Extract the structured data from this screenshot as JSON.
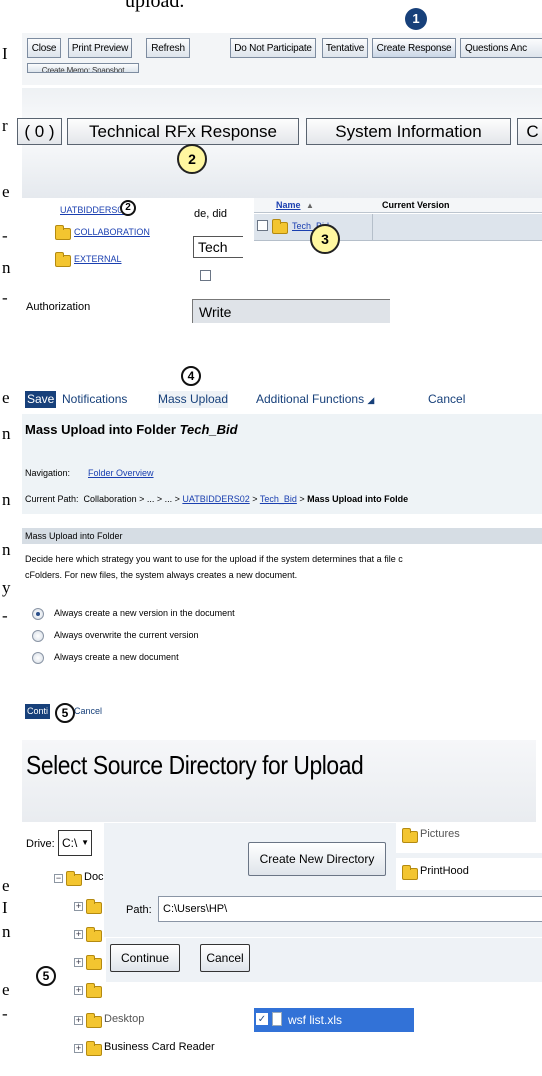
{
  "doc_fragments": {
    "top": "upload.",
    "left_letters": [
      "I",
      "r",
      "e",
      "-",
      "n",
      "-",
      "e",
      "n",
      "n",
      "n",
      "y",
      "-",
      "e",
      "I",
      "n",
      "e",
      "-"
    ]
  },
  "toolbar1": {
    "buttons": [
      "Close",
      "Print Preview",
      "Refresh",
      "Do Not Participate",
      "Tentative",
      "Create Response",
      "Questions Anc"
    ],
    "second_row": "Create Memo: Snapshot"
  },
  "tabs": {
    "count": "( 0 )",
    "technical": "Technical RFx Response",
    "system": "System Information",
    "extra": "C"
  },
  "folders": {
    "tree": [
      "UATBIDDERS02",
      "COLLABORATION",
      "EXTERNAL"
    ],
    "fragment_text": "de, did",
    "tech_field": "Tech",
    "auth_label": "Authorization",
    "auth_value": "Write",
    "col_name": "Name",
    "col_version": "Current Version",
    "row_name": "Tech_Bid"
  },
  "toolbar2": {
    "save": "Save",
    "notifications": "Notifications",
    "mass_upload": "Mass Upload",
    "additional": "Additional Functions",
    "cancel": "Cancel"
  },
  "mass_upload": {
    "title_prefix": "Mass Upload into Folder ",
    "title_folder": "Tech_Bid",
    "nav_label": "Navigation:",
    "nav_link": "Folder Overview",
    "path_label": "Current Path:",
    "path_pre": "Collaboration > ... > ... > ",
    "path_link1": "UATBIDDERS02",
    "path_link2": "Tech_Bid",
    "path_tail": "Mass Upload into Folde",
    "section": "Mass Upload into Folder",
    "desc1": "Decide here which strategy you want to use for the upload if the system determines that a file c",
    "desc2": "cFolders. For new files, the system always creates a new document.",
    "options": [
      "Always create a new version in the document",
      "Always overwrite the current version",
      "Always create a new document"
    ],
    "continue": "Conti",
    "cancel": "Cancel"
  },
  "source_dir": {
    "title": "Select Source Directory for Upload",
    "drive_label": "Drive:",
    "drive_value": "C:\\",
    "tree": [
      "Doc",
      "",
      "",
      "",
      "",
      "Desktop",
      "Business Card Reader"
    ],
    "create_dir": "Create New Directory",
    "path_label": "Path:",
    "path_value": "C:\\Users\\HP\\",
    "continue": "Continue",
    "cancel": "Cancel",
    "right_folders": [
      "Pictures",
      "PrintHood"
    ],
    "file": "wsf list.xls"
  },
  "markers": [
    "1",
    "2",
    "2",
    "3",
    "4",
    "5",
    "5"
  ],
  "colors": {
    "accent": "#17407a",
    "marker_fill": "#fff7a0",
    "sap_header": "#e7ecf0",
    "file_highlight": "#3272d7"
  }
}
